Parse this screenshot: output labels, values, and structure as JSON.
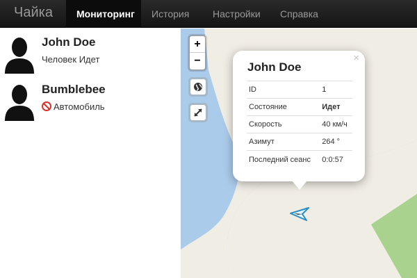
{
  "navbar": {
    "brand": "Чайка",
    "tabs": [
      {
        "label": "Мониторинг",
        "active": true
      },
      {
        "label": "История",
        "active": false
      },
      {
        "label": "Настройки",
        "active": false
      },
      {
        "label": "Справка",
        "active": false
      }
    ]
  },
  "sidebar": {
    "devices": [
      {
        "name": "John Doe",
        "status": "Человек Идет",
        "icon": "person-silhouette-icon"
      },
      {
        "name": "Bumblebee",
        "status": "Автомобиль",
        "status_icon": "offline-icon",
        "icon": "person-silhouette-icon"
      }
    ]
  },
  "map": {
    "zoom_in": "+",
    "zoom_out": "−",
    "controls": [
      "globe-icon",
      "fullscreen-icon"
    ],
    "colors": {
      "water": "#abcbeb",
      "land": "#f0ede5",
      "park": "#a8d28e",
      "marker": "#2a8fc8"
    },
    "popup": {
      "close": "×",
      "title": "John Doe",
      "rows": [
        {
          "label": "ID",
          "value": "1"
        },
        {
          "label": "Состояние",
          "value": "Идет"
        },
        {
          "label": "Скорость",
          "value": "40 км/ч"
        },
        {
          "label": "Азимут",
          "value": "264 °"
        },
        {
          "label": "Последний сеанс",
          "value": "0:0:57"
        }
      ]
    }
  }
}
